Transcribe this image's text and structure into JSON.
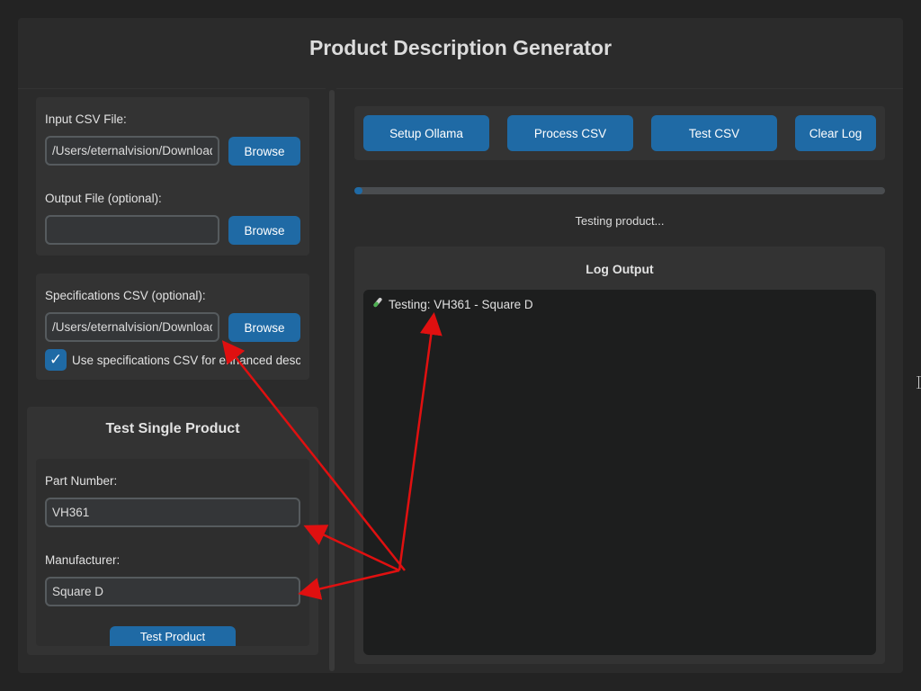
{
  "app": {
    "title": "Product Description Generator"
  },
  "files": {
    "input_label": "Input CSV File:",
    "input_value": "/Users/eternalvision/Download",
    "output_label": "Output File (optional):",
    "output_value": "",
    "browse_label": "Browse"
  },
  "specs": {
    "label": "Specifications CSV (optional):",
    "value": "/Users/eternalvision/Download",
    "browse_label": "Browse",
    "checkbox_label": "Use specifications CSV for enhanced desc",
    "checked": true
  },
  "test": {
    "title": "Test Single Product",
    "part_label": "Part Number:",
    "part_value": "VH361",
    "manufacturer_label": "Manufacturer:",
    "manufacturer_value": "Square D",
    "button_label": "Test Product"
  },
  "toolbar": {
    "setup_label": "Setup Ollama",
    "process_label": "Process CSV",
    "test_label": "Test CSV",
    "clear_label": "Clear Log"
  },
  "progress": {
    "fraction": 0.015,
    "status": "Testing product..."
  },
  "log": {
    "title": "Log Output",
    "lines": [
      {
        "icon": "test-tube-icon",
        "text": "Testing: VH361 - Square D"
      }
    ]
  },
  "colors": {
    "accent": "#1f6aa5",
    "annotation": "#e01010"
  }
}
